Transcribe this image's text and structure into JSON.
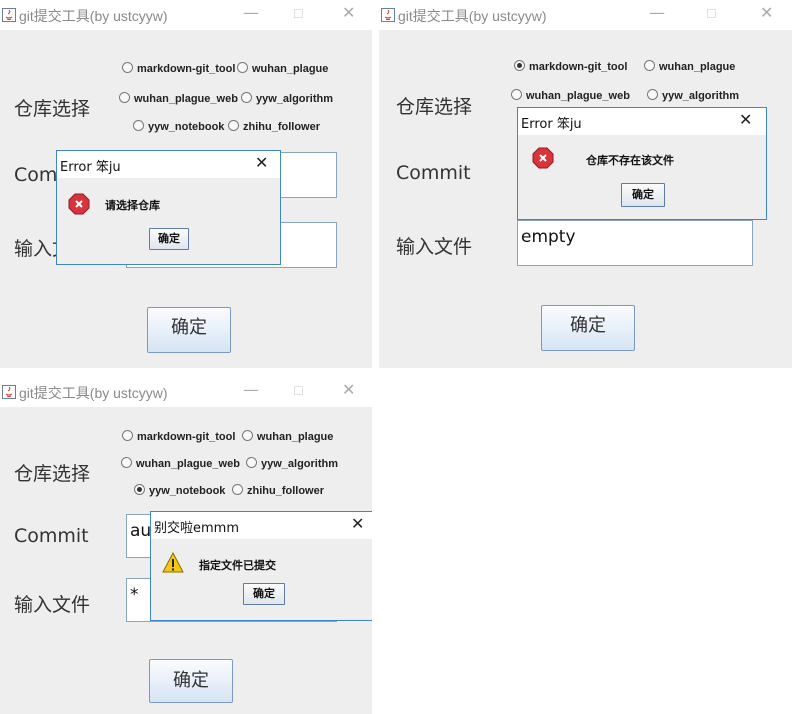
{
  "window_title": "git提交工具(by ustcyyw)",
  "window_controls": {
    "minimize": "—",
    "maximize": "☐",
    "close": "✕"
  },
  "labels": {
    "repo": "仓库选择",
    "commit": "Commit",
    "input_file": "输入文件"
  },
  "repos": [
    "markdown-git_tool",
    "wuhan_plague",
    "wuhan_plague_web",
    "yyw_algorithm",
    "yyw_notebook",
    "zhihu_follower"
  ],
  "confirm_label": "确定",
  "panels": [
    {
      "selected_repo": "none",
      "commit_value": "",
      "input_value": "",
      "dialog": {
        "title": "Error 笨ju",
        "message": "请选择仓库",
        "button": "确定",
        "icon": "error-icon"
      }
    },
    {
      "selected_repo": "markdown-git_tool",
      "commit_value": "",
      "input_value": "empty",
      "dialog": {
        "title": "Error 笨ju",
        "message": "仓库不存在该文件",
        "button": "确定",
        "icon": "error-icon"
      }
    },
    {
      "selected_repo": "yyw_notebook",
      "commit_value": "aut",
      "input_value": "*",
      "dialog": {
        "title": "别交啦emmm",
        "message": "指定文件已提交",
        "button": "确定",
        "icon": "warning-icon"
      }
    }
  ],
  "colors": {
    "window_bg": "#eeeeee",
    "dialog_border": "#3c86c9",
    "error_red": "#d9343c",
    "warning_yellow": "#f5c518"
  }
}
